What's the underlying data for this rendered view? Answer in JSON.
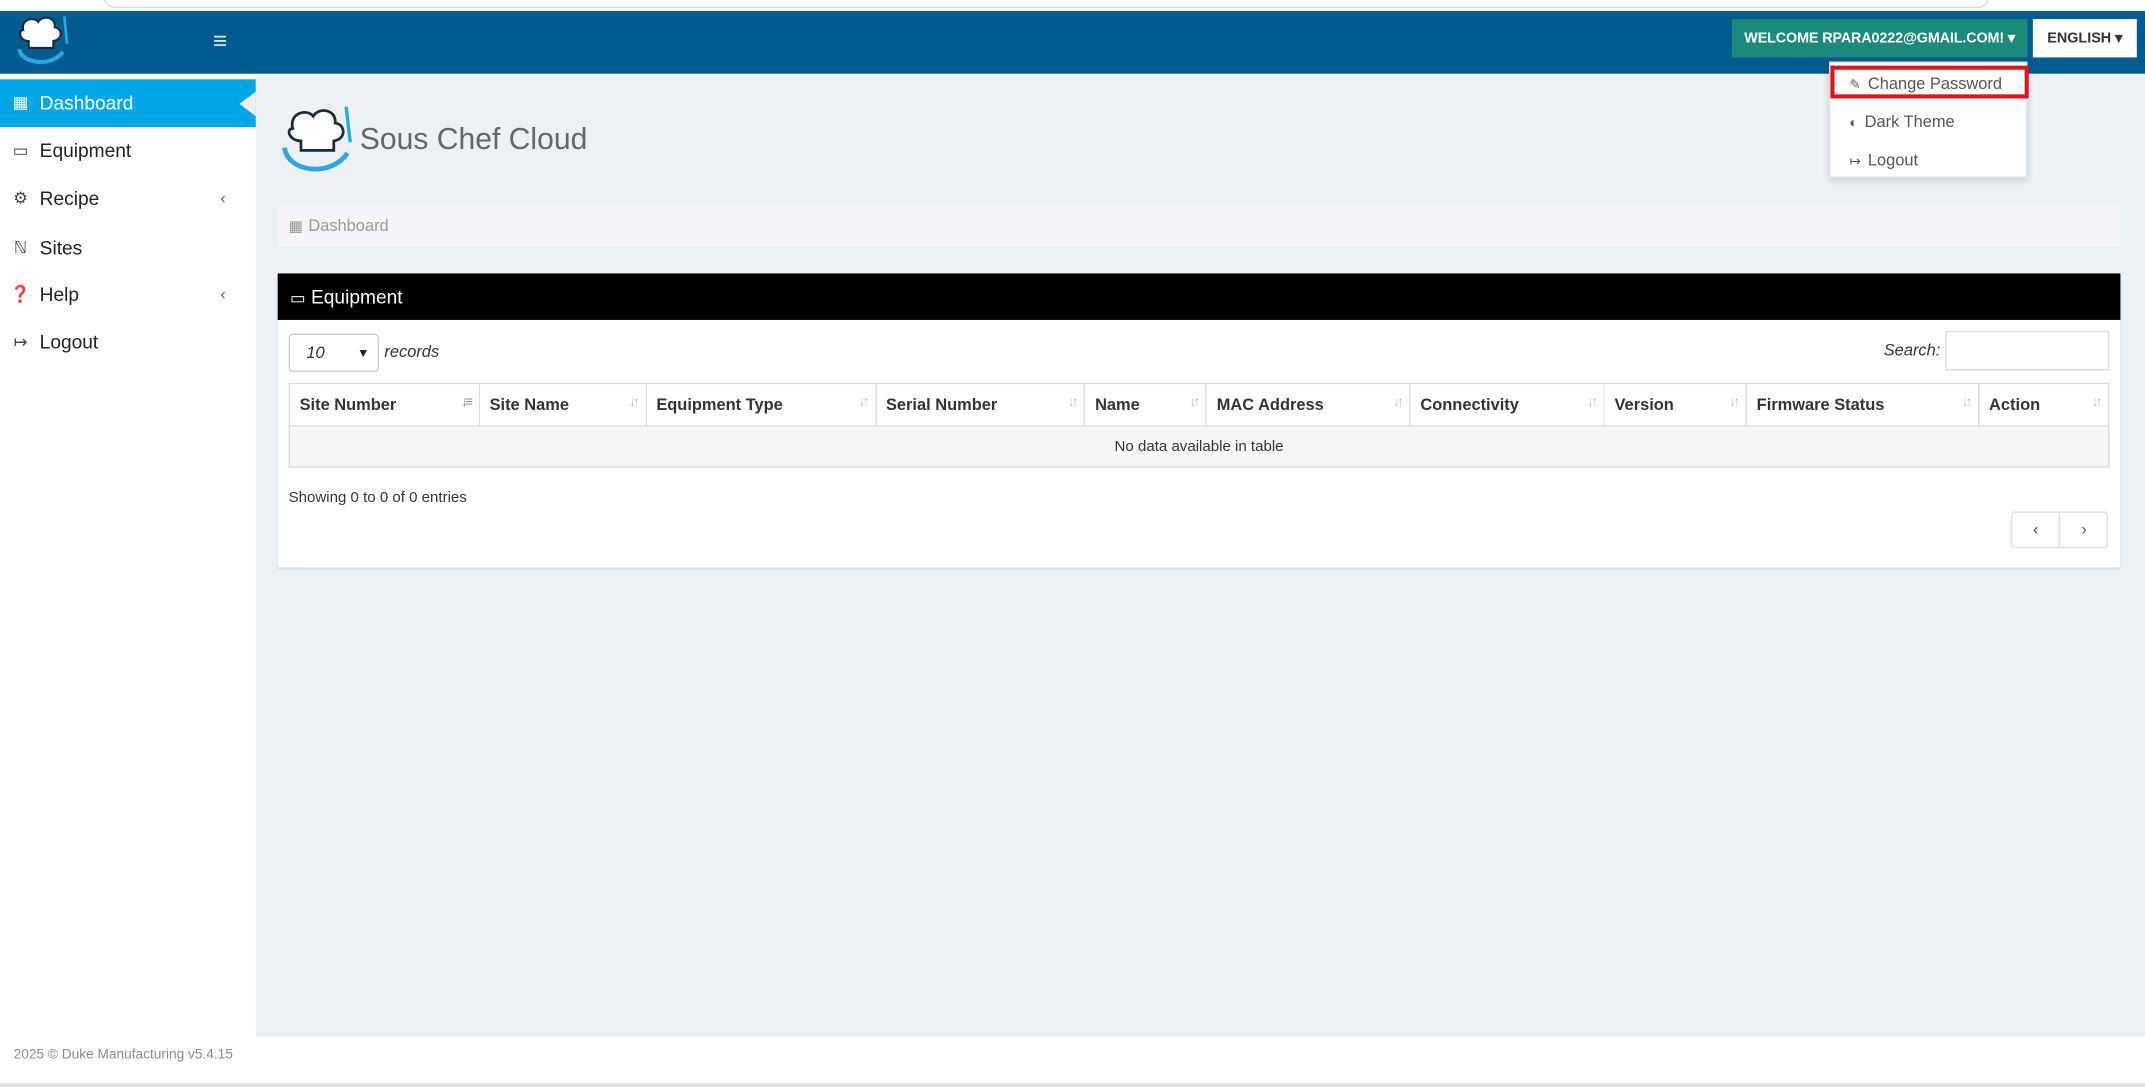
{
  "header": {
    "welcome_label": "WELCOME RPARA0222@GMAIL.COM! ▾",
    "language_label": "ENGLISH ▾",
    "menu_icon": "hamburger-icon"
  },
  "user_menu": {
    "items": [
      {
        "label": "Change Password",
        "icon": "pencil-icon"
      },
      {
        "label": "Dark Theme",
        "icon": "contrast-icon"
      },
      {
        "label": "Logout",
        "icon": "sign-out-icon"
      }
    ]
  },
  "sidebar": {
    "items": [
      {
        "label": "Dashboard",
        "icon": "bar-chart-icon",
        "active": true
      },
      {
        "label": "Equipment",
        "icon": "monitor-icon"
      },
      {
        "label": "Recipe",
        "icon": "gear-icon",
        "chevron": "‹"
      },
      {
        "label": "Sites",
        "icon": "cutlery-icon"
      },
      {
        "label": "Help",
        "icon": "question-circle-icon",
        "chevron": "‹"
      },
      {
        "label": "Logout",
        "icon": "sign-out-icon"
      }
    ],
    "footer": "2025 © Duke Manufacturing v5.4.15"
  },
  "main": {
    "brand_title": "Sous Chef Cloud",
    "breadcrumb": "Dashboard",
    "panel_title": "Equipment",
    "page_length": "10",
    "records_label": "records",
    "search_label": "Search:",
    "search_value": "",
    "columns": [
      "Site Number",
      "Site Name",
      "Equipment Type",
      "Serial Number",
      "Name",
      "MAC Address",
      "Connectivity",
      "Version",
      "Firmware Status",
      "Action"
    ],
    "empty_message": "No data available in table",
    "info": "Showing 0 to 0 of 0 entries",
    "pager_prev": "‹",
    "pager_next": "›"
  },
  "colors": {
    "navbar": "#005b8f",
    "sidebar_active": "#00a6e6",
    "welcome_button": "#1b8a7b",
    "highlight_border": "#e2121b"
  }
}
